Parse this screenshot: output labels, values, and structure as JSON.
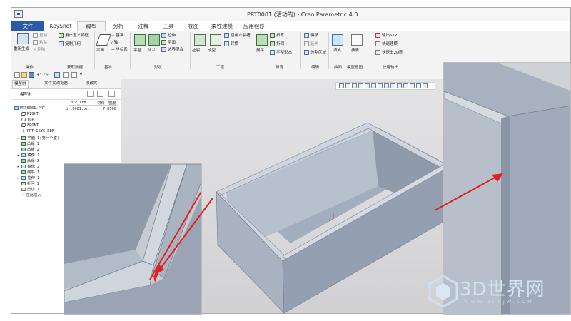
{
  "window": {
    "title": "PRT0001 (活动的) - Creo Parametric 4.0"
  },
  "menu_tabs": [
    {
      "label": "文件"
    },
    {
      "label": "KeyShot"
    },
    {
      "label": "模型"
    },
    {
      "label": "分析"
    },
    {
      "label": "注释"
    },
    {
      "label": "工具"
    },
    {
      "label": "视图"
    },
    {
      "label": "柔性建模"
    },
    {
      "label": "应用程序"
    }
  ],
  "ribbon": {
    "operations": {
      "regen": "重新生成",
      "copy": "复制",
      "paste": "粘贴",
      "delete": "删除",
      "label": "操作"
    },
    "data": {
      "udf": "用户定义特征",
      "copy_geom": "复制几何",
      "label": "获取数据"
    },
    "datum": {
      "plane": "平面",
      "point": "基准",
      "axis": "轴",
      "csys": "坐标系",
      "label": "基准"
    },
    "shapes": {
      "flat": "平整",
      "flange": "法兰",
      "extrude": "拉伸",
      "planar": "平面",
      "blend": "边界混合",
      "label": "形状"
    },
    "engineering": {
      "bend": "扯裂",
      "form": "成型",
      "corner_relief": "拐角止裂槽",
      "convert": "转换",
      "label": "工程"
    },
    "bends": {
      "unbend": "展平",
      "bend": "折弯",
      "flatten": "折回",
      "planar_form": "平整形态",
      "label": "折弯"
    },
    "editing": {
      "mirror": "偏移",
      "pattern": "延伸",
      "split": "分割区域",
      "label": "编辑"
    },
    "surface": {
      "fill": "填充",
      "label": "曲面"
    },
    "model_intent": {
      "table": "族表",
      "label": "模型意图"
    },
    "quick_output": {
      "stp": "输出STP",
      "quick_dwg": "快速建模",
      "export_2d": "快速出2D图",
      "label": "快速输出"
    }
  },
  "left_panel": {
    "tabs": [
      {
        "label": "模型树"
      },
      {
        "label": "文件夹浏览器"
      },
      {
        "label": "收藏夹"
      }
    ],
    "tree_header": "模型树",
    "columns": [
      {
        "label": "ptc_com..."
      },
      {
        "label": "材料"
      },
      {
        "label": "密度"
      }
    ],
    "row_values": {
      "ptc": "prt0001.prt",
      "density": "7.8500"
    },
    "items": [
      {
        "label": "PRT0001.PRT"
      },
      {
        "label": "RIGHT"
      },
      {
        "label": "TOP"
      },
      {
        "label": "FRONT"
      },
      {
        "label": "PRT_CSYS_DEF"
      },
      {
        "label": "平面 1(第一个壁)"
      },
      {
        "label": "凸缘 1"
      },
      {
        "label": "凸缘 2"
      },
      {
        "label": "镜像 1"
      },
      {
        "label": "凸缘 3"
      },
      {
        "label": "镜像 2"
      },
      {
        "label": "展平 1"
      },
      {
        "label": "拉伸 1"
      },
      {
        "label": "折回 1"
      },
      {
        "label": "剪切 1"
      },
      {
        "label": "在此插入"
      }
    ]
  },
  "watermark": {
    "text": "3D世界网",
    "url": "WWW.3DSJW.COM"
  },
  "colors": {
    "file_tab": "#2b5aa7",
    "model_fill": "#a9b4c4",
    "arrow": "#e02020"
  }
}
